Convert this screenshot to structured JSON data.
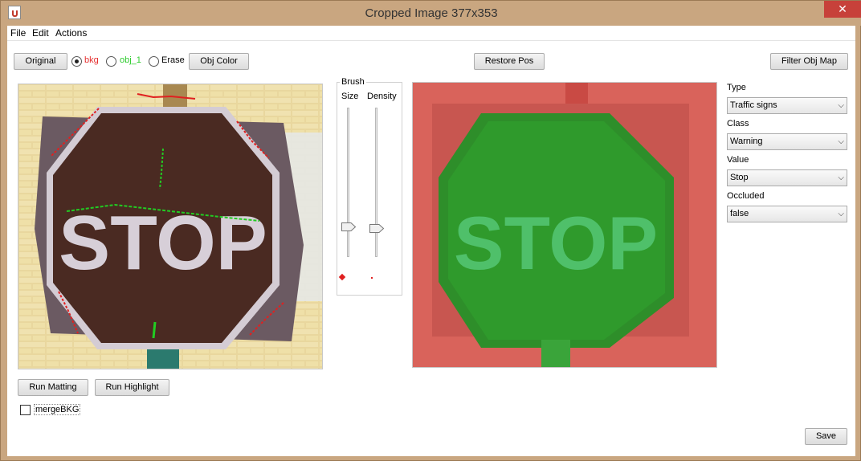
{
  "window": {
    "title": "Cropped Image  377x353",
    "close_glyph": "✕"
  },
  "menu": {
    "file": "File",
    "edit": "Edit",
    "actions": "Actions"
  },
  "toolbar": {
    "original": "Original",
    "radio_bkg": "bkg",
    "radio_obj": "obj_1",
    "radio_erase": "Erase",
    "obj_color": "Obj Color",
    "restore_pos": "Restore Pos",
    "filter_obj_map": "Filter Obj Map"
  },
  "brush": {
    "title": "Brush",
    "size_label": "Size",
    "density_label": "Density"
  },
  "bottom": {
    "run_matting": "Run Matting",
    "run_highlight": "Run Highlight",
    "merge_bkg": "mergeBKG",
    "save": "Save"
  },
  "left_image": {
    "sign_text": "STOP"
  },
  "right_image": {
    "sign_text": "STOP"
  },
  "properties": [
    {
      "label": "Type",
      "value": "Traffic signs"
    },
    {
      "label": "Class",
      "value": "Warning"
    },
    {
      "label": "Value",
      "value": "Stop"
    },
    {
      "label": "Occluded",
      "value": "false"
    }
  ],
  "colors": {
    "bkg_label": "#e53030",
    "obj_label": "#2ecc2e",
    "title_bar": "#c9a680"
  },
  "icons": {
    "combo_arrow": "chevron-down-icon",
    "app": "java-cup-icon"
  }
}
